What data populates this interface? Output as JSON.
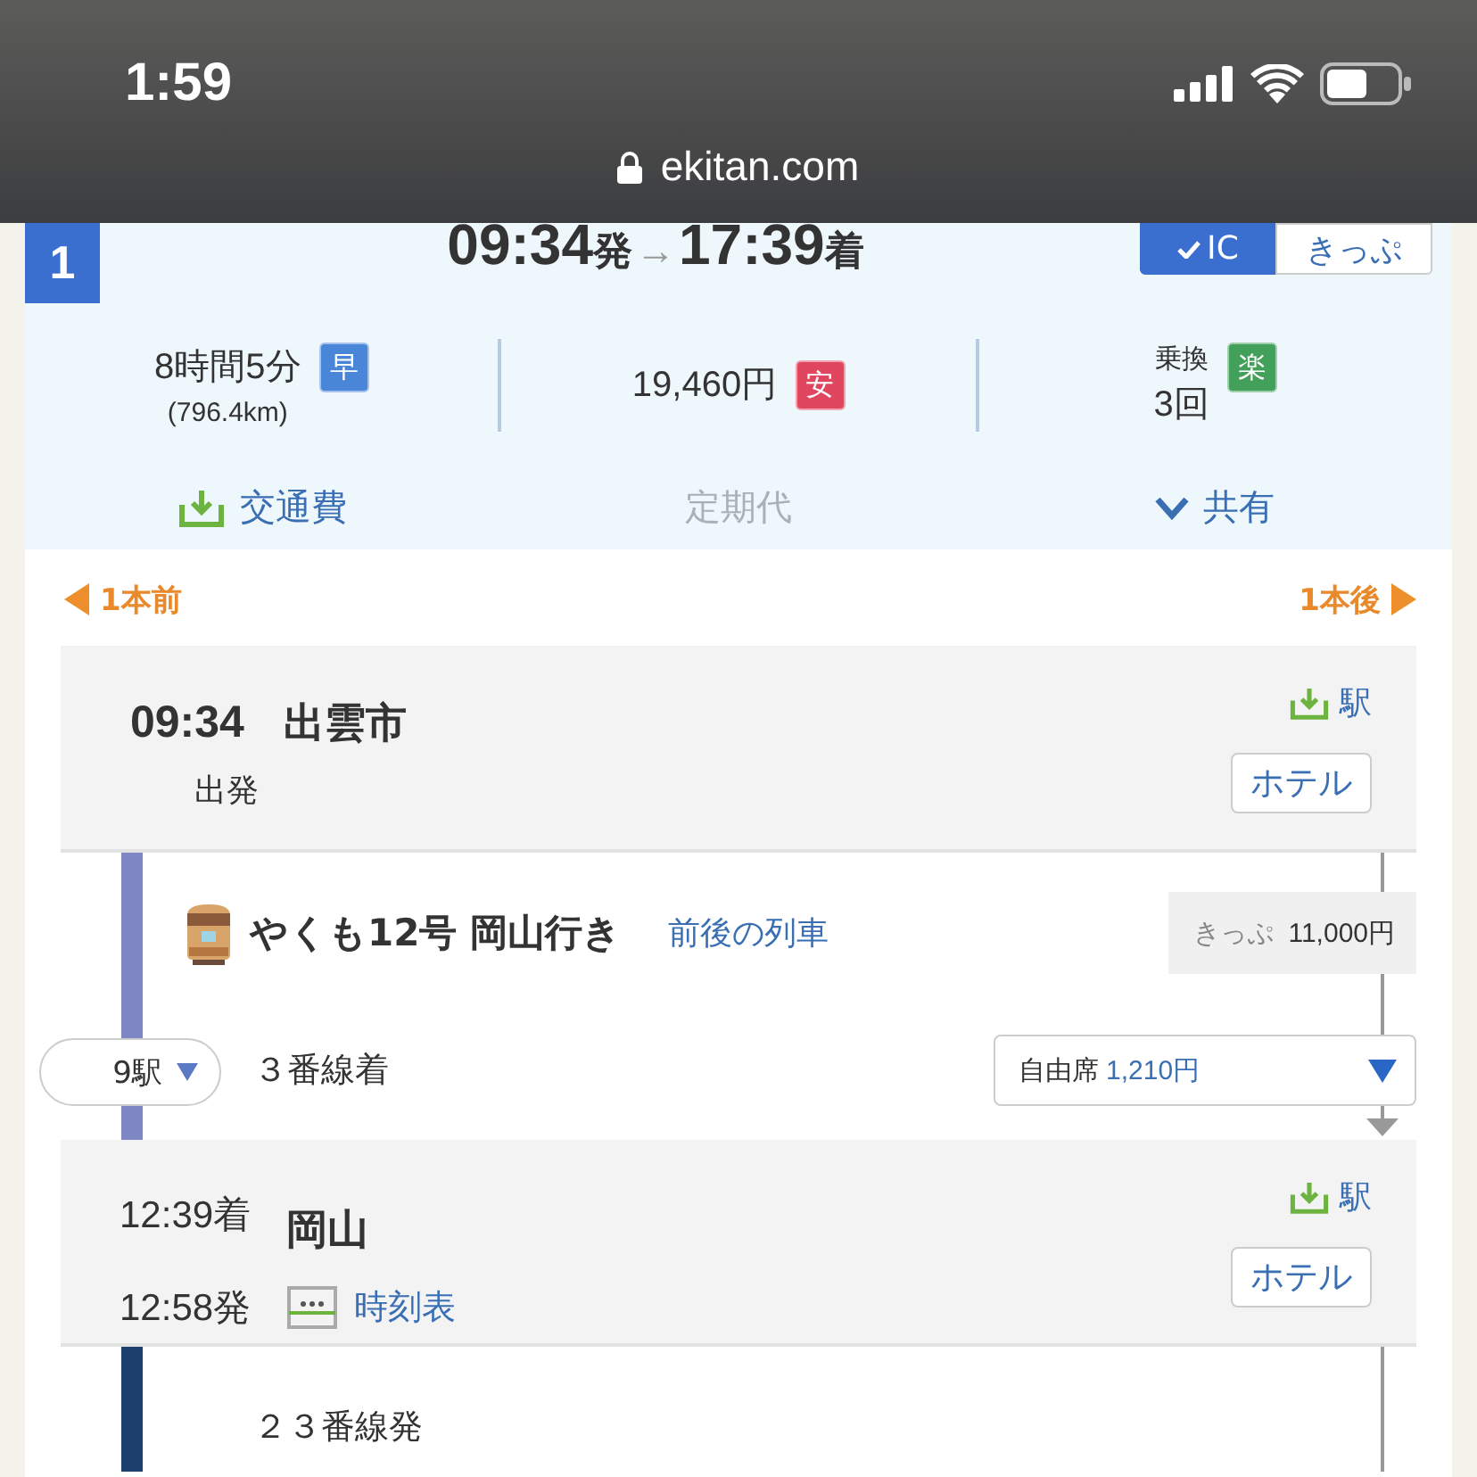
{
  "status_bar": {
    "time": "1:59",
    "url": "ekitan.com"
  },
  "route": {
    "number": "1",
    "departure": "09:34",
    "departure_suffix": "発",
    "arrow": "→",
    "arrival": "17:39",
    "arrival_suffix": "着",
    "fare_types": [
      {
        "label": "IC",
        "selected": true
      },
      {
        "label": "きっぷ",
        "selected": false
      }
    ],
    "stats": [
      {
        "value": "8時間5分",
        "sub": "(796.4km)",
        "badge": "早",
        "color": "#4a86d8"
      },
      {
        "value": "19,460円",
        "badge": "安",
        "color": "#e0465e"
      },
      {
        "label": "乗換",
        "value": "3回",
        "badge": "楽",
        "color": "#43a05a"
      }
    ],
    "actions": [
      {
        "kind": "download",
        "label": "交通費",
        "disabled": false
      },
      {
        "kind": "plain",
        "label": "定期代",
        "disabled": true
      },
      {
        "kind": "expand",
        "label": "共有",
        "disabled": false
      }
    ]
  },
  "navigation": {
    "previous": "1本前",
    "next": "1本後"
  },
  "timeline": [
    {
      "kind": "station",
      "time": "09:34",
      "note": "出発",
      "name": "出雲市",
      "station_link": "駅",
      "hotel": "ホテル"
    },
    {
      "kind": "segment",
      "color": "#7f86c4",
      "train": "やくも12号 岡山行き",
      "trains_link": "前後の列車",
      "fare_label": "きっぷ",
      "fare": "11,000円",
      "stops": "9駅",
      "platform": "３番線着",
      "seat_label": "自由席",
      "seat_price": "1,210円"
    },
    {
      "kind": "transfer",
      "arrive": "12:39着",
      "depart": "12:58発",
      "name": "岡山",
      "timetable": "時刻表",
      "station_link": "駅",
      "hotel": "ホテル"
    },
    {
      "kind": "segment",
      "color": "#1c3f6e",
      "platform": "２３番線発"
    }
  ]
}
